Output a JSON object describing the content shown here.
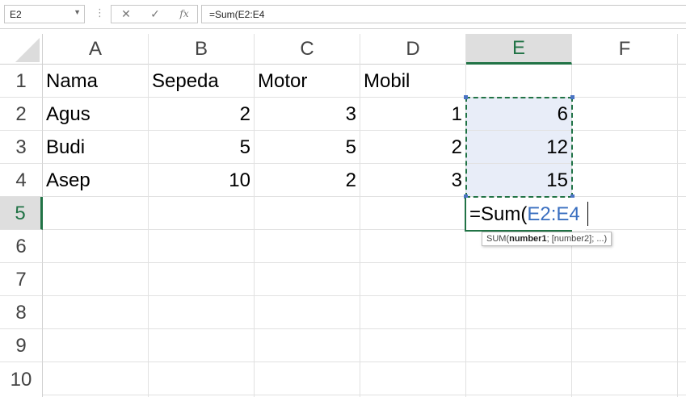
{
  "formula_bar": {
    "name_box": "E2",
    "cancel_icon": "✕",
    "enter_icon": "✓",
    "fx_label": "fx",
    "formula": "=Sum(E2:E4"
  },
  "columns": [
    "A",
    "B",
    "C",
    "D",
    "E",
    "F"
  ],
  "rows": [
    "1",
    "2",
    "3",
    "4",
    "5",
    "6",
    "7",
    "8",
    "9",
    "10"
  ],
  "active_column": "E",
  "active_row": "5",
  "cells": {
    "A1": "Nama",
    "B1": "Sepeda",
    "C1": "Motor",
    "D1": "Mobil",
    "A2": "Agus",
    "B2": "2",
    "C2": "3",
    "D2": "1",
    "E2": "6",
    "A3": "Budi",
    "B3": "5",
    "C3": "5",
    "D3": "2",
    "E3": "12",
    "A4": "Asep",
    "B4": "10",
    "C4": "2",
    "D4": "3",
    "E4": "15"
  },
  "edit": {
    "prefix": "=Sum(",
    "reference": "E2:E4"
  },
  "tooltip": {
    "func": "SUM(",
    "arg1": "number1",
    "rest": "; [number2]; ...)"
  },
  "colors": {
    "accent": "#217346",
    "reference": "#3a6fc0",
    "selection_fill": "#e8edf8"
  }
}
